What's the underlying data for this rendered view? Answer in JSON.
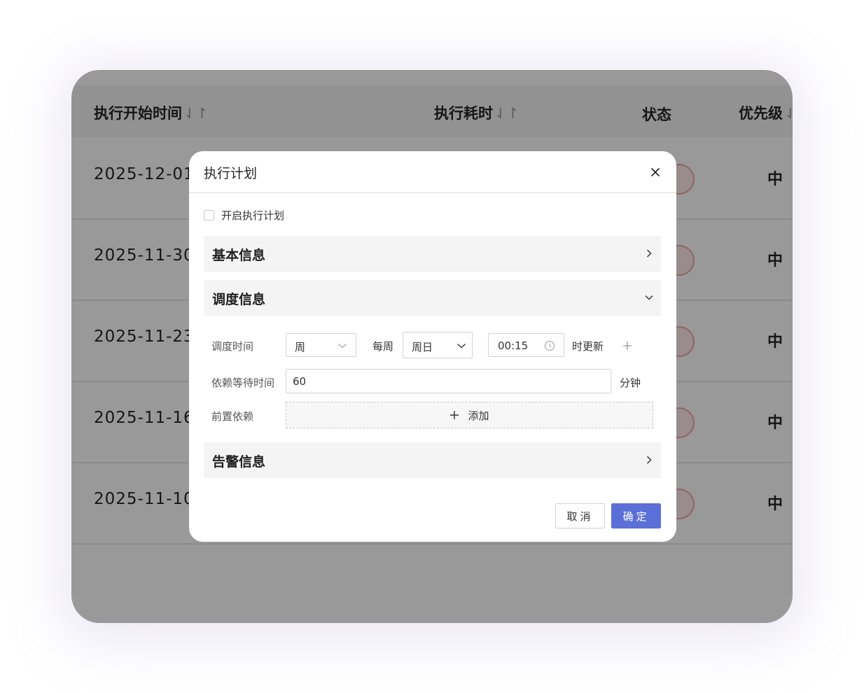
{
  "table": {
    "columns": [
      {
        "label": "执行开始时间",
        "sort_icon": "sort-icon"
      },
      {
        "label": "执行耗时",
        "sort_icon": "sort-icon"
      },
      {
        "label": "状态"
      },
      {
        "label": "优先级"
      }
    ],
    "rows": [
      {
        "date": "2025-12-01",
        "priority": "中"
      },
      {
        "date": "2025-11-30",
        "priority": "中"
      },
      {
        "date": "2025-11-23",
        "priority": "中"
      },
      {
        "date": "2025-11-16",
        "priority": "中"
      },
      {
        "date": "2025-11-10",
        "priority": "中"
      }
    ]
  },
  "modal": {
    "title": "执行计划",
    "close_icon": "close-icon",
    "enable_checkbox": {
      "label": "开启执行计划",
      "checked": false
    },
    "panels": {
      "basic": {
        "title": "基本信息",
        "expanded": false
      },
      "schedule": {
        "title": "调度信息",
        "expanded": true
      },
      "alert": {
        "title": "告警信息",
        "expanded": false
      }
    },
    "schedule": {
      "time_label": "调度时间",
      "period_value": "周",
      "every_label": "每周",
      "day_value": "周日",
      "time_value": "00:15",
      "update_label": "时更新",
      "wait_label": "依赖等待时间",
      "wait_value": "60",
      "wait_unit": "分钟",
      "prereq_label": "前置依赖",
      "add_label": "添加"
    },
    "buttons": {
      "cancel": "取消",
      "ok": "确定"
    },
    "colors": {
      "primary": "#5b6fd8",
      "status_ring": "#f2a5a5"
    }
  }
}
